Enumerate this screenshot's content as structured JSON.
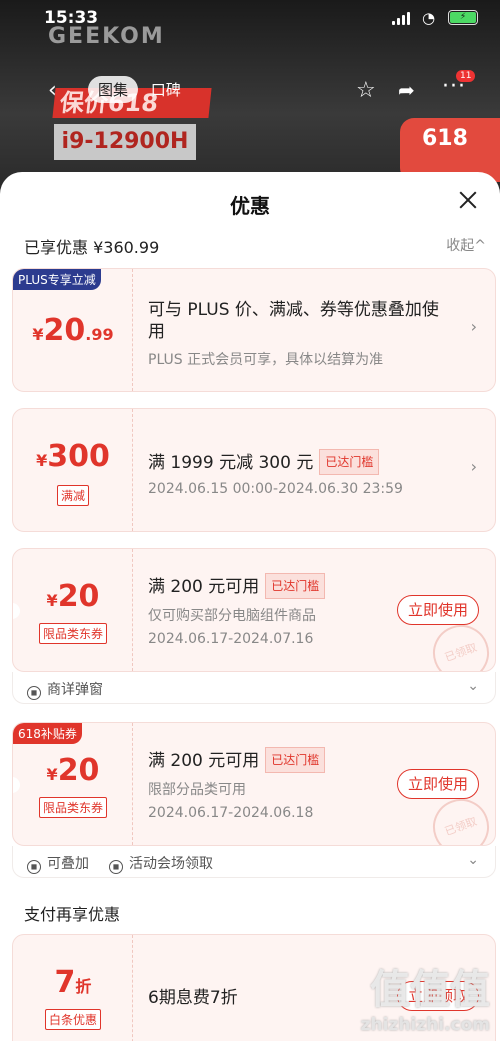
{
  "status": {
    "time": "15:33"
  },
  "nav": {
    "brand": "GEEKOM",
    "tabs": [
      "图集",
      "口碑"
    ],
    "badge": "11"
  },
  "background": {
    "promo_cpu": "i9-12900H",
    "promo_brand": "保价618",
    "promo_sale": "618"
  },
  "sheet": {
    "title": "优惠",
    "summary": "已享优惠 ¥360.99",
    "collapse": "收起^"
  },
  "cards": [
    {
      "corner": "PLUS专享立减",
      "cur": "¥",
      "num": "20",
      "dec": ".99",
      "line1": "可与 PLUS 价、满减、券等优惠叠加使用",
      "line2": "PLUS 正式会员可享，具体以结算为准"
    },
    {
      "cur": "¥",
      "num": "300",
      "tag": "满减",
      "line1": "满 1999 元减 300 元",
      "pill": "已达门槛",
      "line2": "2024.06.15 00:00-2024.06.30 23:59"
    },
    {
      "cur": "¥",
      "num": "20",
      "tag": "限品类东券",
      "line1": "满 200 元可用",
      "pill": "已达门槛",
      "line2": "仅可购买部分电脑组件商品",
      "line3": "2024.06.17-2024.07.16",
      "button": "立即使用",
      "stamp": "已领取",
      "footer": [
        "商详弹窗"
      ]
    },
    {
      "corner": "618补贴券",
      "cur": "¥",
      "num": "20",
      "tag": "限品类东券",
      "line1": "满 200 元可用",
      "pill": "已达门槛",
      "line2": "限部分品类可用",
      "line3": "2024.06.17-2024.06.18",
      "button": "立即使用",
      "stamp": "已领取",
      "footer": [
        "可叠加",
        "活动会场领取"
      ]
    },
    {
      "num": "7",
      "unit": "折",
      "tag": "白条优惠",
      "line1": "6期息费7折",
      "button": "立即领取"
    }
  ],
  "section2": "支付再享优惠",
  "watermark": {
    "big": "值值值",
    "small": "zhizhizhi.com"
  },
  "colors": {
    "accent": "#e0352b",
    "card_bg": "#fef4f2",
    "plus_corner": "#2c3b8f"
  }
}
